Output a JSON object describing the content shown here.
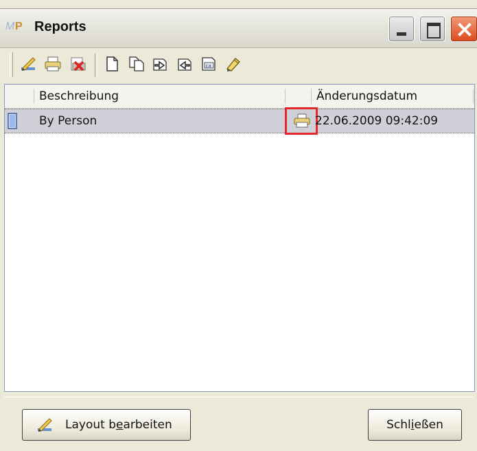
{
  "window": {
    "title": "Reports"
  },
  "toolbar": {
    "items": [
      {
        "name": "edit-layout-icon"
      },
      {
        "name": "print-icon"
      },
      {
        "name": "delete-icon"
      },
      {
        "name": "new-document-icon"
      },
      {
        "name": "copy-document-icon"
      },
      {
        "name": "import-icon"
      },
      {
        "name": "export-icon"
      },
      {
        "name": "rename-icon"
      },
      {
        "name": "properties-icon"
      }
    ]
  },
  "list": {
    "columns": [
      "Beschreibung",
      "Änderungsdatum"
    ],
    "rows": [
      {
        "name": "By Person",
        "date": "22.06.2009 09:42:09",
        "icon": "printer-icon"
      }
    ]
  },
  "buttons": {
    "layout_pre": "Layout b",
    "layout_mnemonic": "e",
    "layout_post": "arbeiten",
    "close_pre": "Schl",
    "close_mnemonic": "i",
    "close_post": "eßen"
  },
  "colors": {
    "highlight": "#e32929",
    "selected_row": "#d1d0d8"
  }
}
